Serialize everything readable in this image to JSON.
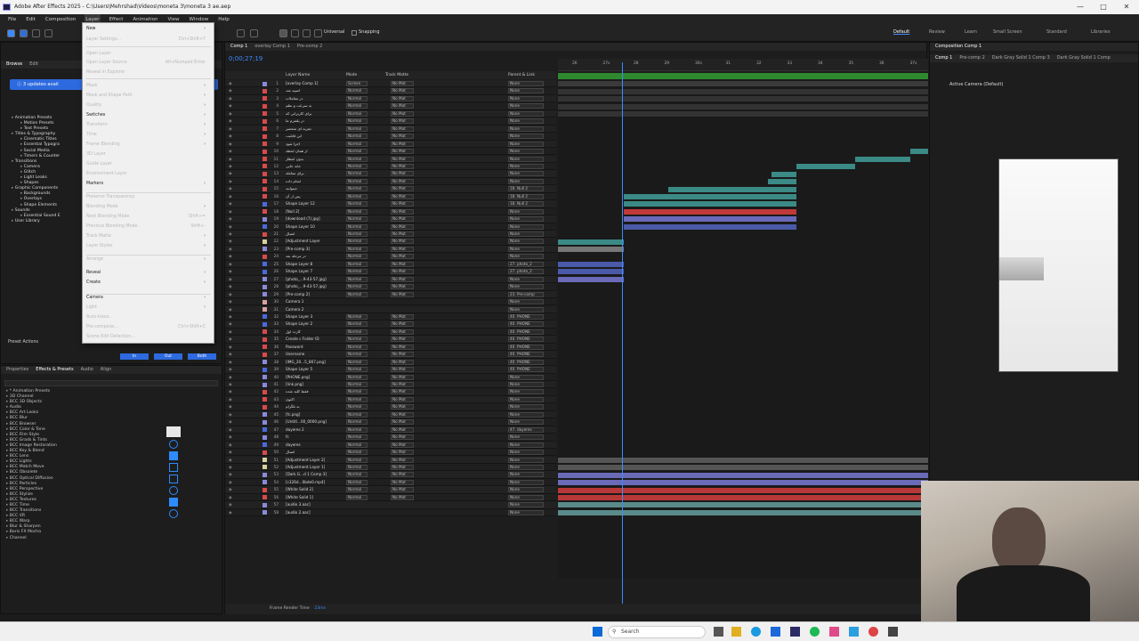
{
  "window": {
    "title": "Adobe After Effects 2025 - C:\\Users\\Mehrshad\\Videos\\moneta 3\\moneta 3 ae.aep"
  },
  "menubar": [
    "File",
    "Edit",
    "Composition",
    "Layer",
    "Effect",
    "Animation",
    "View",
    "Window",
    "Help"
  ],
  "toolbar": {
    "universal_label": "Universal",
    "snapping_label": "Snapping",
    "workspaces": [
      "Default",
      "Review",
      "Learn",
      "Small Screen",
      "Standard",
      "Libraries"
    ]
  },
  "layer_menu": {
    "items": [
      {
        "label": "New",
        "enabled": true,
        "submenu": true
      },
      {
        "label": "Layer Settings...",
        "enabled": false,
        "shortcut": "Ctrl+Shift+Y"
      },
      {
        "label": "Open Layer",
        "enabled": false
      },
      {
        "label": "Open Layer Source",
        "enabled": false,
        "shortcut": "Alt+Numpad Enter"
      },
      {
        "label": "Reveal in Explorer",
        "enabled": false
      },
      {
        "label": "Mask",
        "enabled": false,
        "submenu": true
      },
      {
        "label": "Mask and Shape Path",
        "enabled": false,
        "submenu": true
      },
      {
        "label": "Quality",
        "enabled": false,
        "submenu": true
      },
      {
        "label": "Switches",
        "enabled": true,
        "submenu": true
      },
      {
        "label": "Transform",
        "enabled": false,
        "submenu": true
      },
      {
        "label": "Time",
        "enabled": false,
        "submenu": true
      },
      {
        "label": "Frame Blending",
        "enabled": false,
        "submenu": true
      },
      {
        "label": "3D Layer",
        "enabled": false
      },
      {
        "label": "Guide Layer",
        "enabled": false
      },
      {
        "label": "Environment Layer",
        "enabled": false
      },
      {
        "label": "Markers",
        "enabled": true,
        "submenu": true
      },
      {
        "label": "Preserve Transparency",
        "enabled": false
      },
      {
        "label": "Blending Mode",
        "enabled": false,
        "submenu": true
      },
      {
        "label": "Next Blending Mode",
        "enabled": false,
        "shortcut": "Shift+="
      },
      {
        "label": "Previous Blending Mode",
        "enabled": false,
        "shortcut": "Shift+-"
      },
      {
        "label": "Track Matte",
        "enabled": false,
        "submenu": true
      },
      {
        "label": "Layer Styles",
        "enabled": false,
        "submenu": true
      },
      {
        "label": "Arrange",
        "enabled": false,
        "submenu": true
      },
      {
        "label": "Reveal",
        "enabled": true,
        "submenu": true
      },
      {
        "label": "Create",
        "enabled": true,
        "submenu": true
      },
      {
        "label": "Camera",
        "enabled": true,
        "submenu": true
      },
      {
        "label": "Light",
        "enabled": false,
        "submenu": true
      },
      {
        "label": "Auto-trace...",
        "enabled": false
      },
      {
        "label": "Pre-compose...",
        "enabled": false,
        "shortcut": "Ctrl+Shift+C"
      },
      {
        "label": "Scene Edit Detection...",
        "enabled": false
      }
    ]
  },
  "project_panel": {
    "tabs": [
      "Browse",
      "Edit"
    ],
    "update_notice": "3 updates avail",
    "library_items": [
      "Animation Presets",
      "Motion Presets",
      "Text Presets",
      "Titles & Typography",
      "Cinematic Titles",
      "Essential Typogra",
      "Social Media",
      "Timers & Counter",
      "Transitions",
      "Camera",
      "Glitch",
      "Light Leaks",
      "Shapes",
      "Graphic Components",
      "Backgrounds",
      "Overlays",
      "Shape Elements",
      "Sounds",
      "Essential Sound E",
      "User Library"
    ],
    "preset_actions_label": "Preset Actions",
    "in_label": "In",
    "out_label": "Out",
    "both_label": "Both"
  },
  "effects_panel": {
    "tabs": [
      "Properties",
      "Effects & Presets",
      "Audio",
      "Align"
    ],
    "items": [
      "* Animation Presets",
      "3D Channel",
      "BCC 3D Objects",
      "Audio",
      "BCC Art Looks",
      "BCC Blur",
      "BCC Browser",
      "BCC Color & Tone",
      "BCC Film Style",
      "BCC Grads & Tints",
      "BCC Image Restoration",
      "BCC Key & Blend",
      "BCC Lens",
      "BCC Lights",
      "BCC Match Move",
      "BCC Obsolete",
      "BCC Optical Diffusion",
      "BCC Particles",
      "BCC Perspective",
      "BCC Stylize",
      "BCC Textures",
      "BCC Time",
      "BCC Transitions",
      "BCC VR",
      "BCC Warp",
      "Blur & Sharpen",
      "Boris FX Mocha",
      "Channel"
    ]
  },
  "timeline": {
    "tabs": [
      "Comp 1",
      "overlay Comp 1",
      "Pre-comp 2"
    ],
    "timecode": "0;00;27;19",
    "column_headers": [
      "Layer Name",
      "Mode",
      "Track Matte",
      "Parent & Link"
    ],
    "ruler_ticks": [
      "26",
      "27s",
      "28",
      "29",
      "30s",
      "31",
      "32",
      "33",
      "34",
      "35",
      "36",
      "37s"
    ],
    "footer_label": "Frame Render Time",
    "footer_value": "23ms",
    "layers": [
      {
        "n": "1",
        "name": "[overlay Comp 1]",
        "mode": "Screen",
        "matte": "No Mat",
        "parent": "None",
        "color": "#8a8ad8"
      },
      {
        "n": "2",
        "name": "اسپید شد",
        "mode": "Normal",
        "matte": "No Mat",
        "parent": "None",
        "color": "#d84a4a"
      },
      {
        "n": "3",
        "name": "در معاملات",
        "mode": "Normal",
        "matte": "No Mat",
        "parent": "None",
        "color": "#d84a4a"
      },
      {
        "n": "4",
        "name": "به سرعت و نظم",
        "mode": "Normal",
        "matte": "No Mat",
        "parent": "None",
        "color": "#d84a4a"
      },
      {
        "n": "5",
        "name": "برای کاربرانی که",
        "mode": "Normal",
        "matte": "No Mat",
        "parent": "None",
        "color": "#d84a4a"
      },
      {
        "n": "6",
        "name": "در پلتفرم ما",
        "mode": "Normal",
        "matte": "No Mat",
        "parent": "None",
        "color": "#d84a4a"
      },
      {
        "n": "7",
        "name": "تجربه ای منحصر",
        "mode": "Normal",
        "matte": "No Mat",
        "parent": "None",
        "color": "#d84a4a"
      },
      {
        "n": "8",
        "name": "این قابلیت",
        "mode": "Normal",
        "matte": "No Mat",
        "parent": "None",
        "color": "#d84a4a"
      },
      {
        "n": "9",
        "name": "اجرا شود",
        "mode": "Normal",
        "matte": "No Mat",
        "parent": "None",
        "color": "#d84a4a"
      },
      {
        "n": "10",
        "name": "از همان لحظه",
        "mode": "Normal",
        "matte": "No Mat",
        "parent": "None",
        "color": "#d84a4a"
      },
      {
        "n": "11",
        "name": "بدون انتظار",
        "mode": "Normal",
        "matte": "No Mat",
        "parent": "None",
        "color": "#d84a4a"
      },
      {
        "n": "12",
        "name": "جابه جایی",
        "mode": "Normal",
        "matte": "No Mat",
        "parent": "None",
        "color": "#d84a4a"
      },
      {
        "n": "13",
        "name": "برای معامله",
        "mode": "Normal",
        "matte": "No Mat",
        "parent": "None",
        "color": "#d84a4a"
      },
      {
        "n": "14",
        "name": "انجام داده",
        "mode": "Normal",
        "matte": "No Mat",
        "parent": "None",
        "color": "#d84a4a"
      },
      {
        "n": "15",
        "name": "میتوانید",
        "mode": "Normal",
        "matte": "No Mat",
        "parent": "18. Null 2",
        "color": "#d84a4a"
      },
      {
        "n": "16",
        "name": "پس از آن",
        "mode": "Normal",
        "matte": "No Mat",
        "parent": "18. Null 2",
        "color": "#d84a4a"
      },
      {
        "n": "17",
        "name": "Shape Layer 12",
        "mode": "Normal",
        "matte": "No Mat",
        "parent": "18. Null 2",
        "color": "#4a6ad8"
      },
      {
        "n": "18",
        "name": "[Null 2]",
        "mode": "Normal",
        "matte": "No Mat",
        "parent": "None",
        "color": "#d84a4a"
      },
      {
        "n": "19",
        "name": "[download (7).jpg]",
        "mode": "Normal",
        "matte": "No Mat",
        "parent": "None",
        "color": "#8a8ad8"
      },
      {
        "n": "20",
        "name": "Shape Layer 10",
        "mode": "Normal",
        "matte": "No Mat",
        "parent": "None",
        "color": "#4a6ad8"
      },
      {
        "n": "21",
        "name": "اتصال",
        "mode": "Normal",
        "matte": "No Mat",
        "parent": "None",
        "color": "#d84a4a"
      },
      {
        "n": "22",
        "name": "[Adjustment Layer",
        "mode": "Normal",
        "matte": "No Mat",
        "parent": "None",
        "color": "#d8d0a0"
      },
      {
        "n": "23",
        "name": "[Pre-comp 3]",
        "mode": "Normal",
        "matte": "No Mat",
        "parent": "None",
        "color": "#8a8ad8"
      },
      {
        "n": "24",
        "name": "در مرحله بعد",
        "mode": "Normal",
        "matte": "No Mat",
        "parent": "None",
        "color": "#d84a4a"
      },
      {
        "n": "25",
        "name": "Shape Layer 8",
        "mode": "Normal",
        "matte": "No Mat",
        "parent": "27. photo_2",
        "color": "#4a6ad8"
      },
      {
        "n": "26",
        "name": "Shape Layer 7",
        "mode": "Normal",
        "matte": "No Mat",
        "parent": "27. photo_2",
        "color": "#4a6ad8"
      },
      {
        "n": "27",
        "name": "[photo_...9-43-57.jpg]",
        "mode": "Normal",
        "matte": "No Mat",
        "parent": "None",
        "color": "#8a8ad8"
      },
      {
        "n": "28",
        "name": "[photo_...9-43-57.jpg]",
        "mode": "Normal",
        "matte": "No Mat",
        "parent": "None",
        "color": "#8a8ad8"
      },
      {
        "n": "29",
        "name": "[Pre-comp 2]",
        "mode": "Normal",
        "matte": "No Mat",
        "parent": "23. Pre-comp",
        "color": "#8a8ad8"
      },
      {
        "n": "30",
        "name": "Camera 1",
        "mode": "",
        "matte": "",
        "parent": "None",
        "color": "#d8a0a0"
      },
      {
        "n": "31",
        "name": "Camera 2",
        "mode": "",
        "matte": "",
        "parent": "None",
        "color": "#d8a0a0"
      },
      {
        "n": "32",
        "name": "Shape Layer 3",
        "mode": "Normal",
        "matte": "No Mat",
        "parent": "40. PHONE",
        "color": "#4a6ad8"
      },
      {
        "n": "33",
        "name": "Shape Layer 2",
        "mode": "Normal",
        "matte": "No Mat",
        "parent": "40. PHONE",
        "color": "#4a6ad8"
      },
      {
        "n": "34",
        "name": "کارت اول",
        "mode": "Normal",
        "matte": "No Mat",
        "parent": "40. PHONE",
        "color": "#d84a4a"
      },
      {
        "n": "35",
        "name": "Create c Folder ID",
        "mode": "Normal",
        "matte": "No Mat",
        "parent": "40. PHONE",
        "color": "#d84a4a"
      },
      {
        "n": "36",
        "name": "Password",
        "mode": "Normal",
        "matte": "No Mat",
        "parent": "40. PHONE",
        "color": "#d84a4a"
      },
      {
        "n": "37",
        "name": "Username",
        "mode": "Normal",
        "matte": "No Mat",
        "parent": "40. PHONE",
        "color": "#d84a4a"
      },
      {
        "n": "38",
        "name": "[IMG_20...5_867.png]",
        "mode": "Normal",
        "matte": "No Mat",
        "parent": "40. PHONE",
        "color": "#8a8ad8"
      },
      {
        "n": "39",
        "name": "Shape Layer 5",
        "mode": "Normal",
        "matte": "No Mat",
        "parent": "40. PHONE",
        "color": "#4a6ad8"
      },
      {
        "n": "40",
        "name": "[PHONE.png]",
        "mode": "Normal",
        "matte": "No Mat",
        "parent": "None",
        "color": "#8a8ad8"
      },
      {
        "n": "41",
        "name": "[link.png]",
        "mode": "Normal",
        "matte": "No Mat",
        "parent": "None",
        "color": "#8a8ad8"
      },
      {
        "n": "42",
        "name": "فقط کلید شده",
        "mode": "Normal",
        "matte": "No Mat",
        "parent": "None",
        "color": "#d84a4a"
      },
      {
        "n": "43",
        "name": "اکنون",
        "mode": "Normal",
        "matte": "No Mat",
        "parent": "None",
        "color": "#d84a4a"
      },
      {
        "n": "44",
        "name": "به تلگرام",
        "mode": "Normal",
        "matte": "No Mat",
        "parent": "None",
        "color": "#d84a4a"
      },
      {
        "n": "45",
        "name": "[fc.png]",
        "mode": "Normal",
        "matte": "No Mat",
        "parent": "None",
        "color": "#8a8ad8"
      },
      {
        "n": "46",
        "name": "[Untitl...00_0000.png]",
        "mode": "Normal",
        "matte": "No Mat",
        "parent": "None",
        "color": "#8a8ad8"
      },
      {
        "n": "47",
        "name": "dayeres 2",
        "mode": "Normal",
        "matte": "No Mat",
        "parent": "47. dayeres",
        "color": "#4a6ad8"
      },
      {
        "n": "48",
        "name": "fc",
        "mode": "Normal",
        "matte": "No Mat",
        "parent": "None",
        "color": "#8a8ad8"
      },
      {
        "n": "49",
        "name": "dayeres",
        "mode": "Normal",
        "matte": "No Mat",
        "parent": "None",
        "color": "#4a6ad8"
      },
      {
        "n": "50",
        "name": "اتصال",
        "mode": "Normal",
        "matte": "No Mat",
        "parent": "None",
        "color": "#d84a4a"
      },
      {
        "n": "51",
        "name": "[Adjustment Layer 2]",
        "mode": "Normal",
        "matte": "No Mat",
        "parent": "None",
        "color": "#d8d0a0"
      },
      {
        "n": "52",
        "name": "[Adjustment Layer 1]",
        "mode": "Normal",
        "matte": "No Mat",
        "parent": "None",
        "color": "#d8d0a0"
      },
      {
        "n": "53",
        "name": "[Dark G...d 1 Comp 3]",
        "mode": "Normal",
        "matte": "No Mat",
        "parent": "None",
        "color": "#8a8ad8"
      },
      {
        "n": "54",
        "name": "[c326d...0bde0.mp4]",
        "mode": "Normal",
        "matte": "No Mat",
        "parent": "None",
        "color": "#8a8ad8"
      },
      {
        "n": "55",
        "name": "[White Solid 2]",
        "mode": "Normal",
        "matte": "No Mat",
        "parent": "None",
        "color": "#d84a4a"
      },
      {
        "n": "56",
        "name": "[White Solid 1]",
        "mode": "Normal",
        "matte": "No Mat",
        "parent": "None",
        "color": "#d84a4a"
      },
      {
        "n": "57",
        "name": "[audio 3.aac]",
        "mode": "",
        "matte": "",
        "parent": "None",
        "color": "#8a8ad8"
      },
      {
        "n": "58",
        "name": "[audio 2.aac]",
        "mode": "",
        "matte": "",
        "parent": "None",
        "color": "#8a8ad8"
      }
    ]
  },
  "viewer": {
    "tabs": [
      "Comp 1",
      "Pre-comp 2",
      "Dark Gray Solid 1 Comp 3",
      "Dark Gray Solid 1 Comp"
    ],
    "panel_title": "Composition Comp 1",
    "camera_label": "Active Camera (Default)"
  },
  "taskbar": {
    "search_placeholder": "Search"
  }
}
